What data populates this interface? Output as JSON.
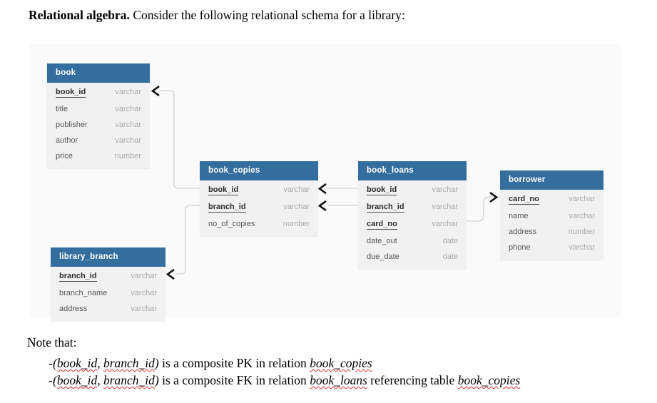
{
  "intro": {
    "lead": "Relational algebra.",
    "rest": " Consider the following relational schema for a library:"
  },
  "diagram": {
    "background_color": "#fafafa",
    "header_color": "#336e9e",
    "body_color": "#f1f1f1",
    "entities": [
      {
        "id": "book",
        "name": "book",
        "attributes": [
          {
            "name": "book_id",
            "type": "varchar",
            "key": true
          },
          {
            "name": "title",
            "type": "varchar",
            "key": false
          },
          {
            "name": "publisher",
            "type": "varchar",
            "key": false
          },
          {
            "name": "author",
            "type": "varchar",
            "key": false
          },
          {
            "name": "price",
            "type": "number",
            "key": false
          }
        ]
      },
      {
        "id": "book_copies",
        "name": "book_copies",
        "attributes": [
          {
            "name": "book_id",
            "type": "varchar",
            "key": true
          },
          {
            "name": "branch_id",
            "type": "varchar",
            "key": true
          },
          {
            "name": "no_of_copies",
            "type": "number",
            "key": false
          }
        ]
      },
      {
        "id": "book_loans",
        "name": "book_loans",
        "attributes": [
          {
            "name": "book_id",
            "type": "varchar",
            "key": true
          },
          {
            "name": "branch_id",
            "type": "varchar",
            "key": true
          },
          {
            "name": "card_no",
            "type": "varchar",
            "key": true
          },
          {
            "name": "date_out",
            "type": "date",
            "key": false
          },
          {
            "name": "due_date",
            "type": "date",
            "key": false
          }
        ]
      },
      {
        "id": "borrower",
        "name": "borrower",
        "attributes": [
          {
            "name": "card_no",
            "type": "varchar",
            "key": true
          },
          {
            "name": "name",
            "type": "varchar",
            "key": false
          },
          {
            "name": "address",
            "type": "number",
            "key": false
          },
          {
            "name": "phone",
            "type": "varchar",
            "key": false
          }
        ]
      },
      {
        "id": "library_branch",
        "name": "library_branch",
        "attributes": [
          {
            "name": "branch_id",
            "type": "varchar",
            "key": true
          },
          {
            "name": "branch_name",
            "type": "varchar",
            "key": false
          },
          {
            "name": "address",
            "type": "varchar",
            "key": false
          }
        ]
      }
    ]
  },
  "notes": {
    "heading": "Note that:",
    "bullet_marker": "-",
    "items": [
      {
        "open_paren": "(",
        "field_a": "book_id",
        "comma": ", ",
        "field_b": "branch_id",
        "close_paren": ")",
        "middle": " is a composite PK in relation ",
        "relation_a": "book_copies",
        "tail": "",
        "relation_b": ""
      },
      {
        "open_paren": "(",
        "field_a": "book_id",
        "comma": ", ",
        "field_b": "branch_id",
        "close_paren": ")",
        "middle": " is a composite FK in relation ",
        "relation_a": "book_loans",
        "tail": " referencing table ",
        "relation_b": "book_copies"
      }
    ]
  }
}
